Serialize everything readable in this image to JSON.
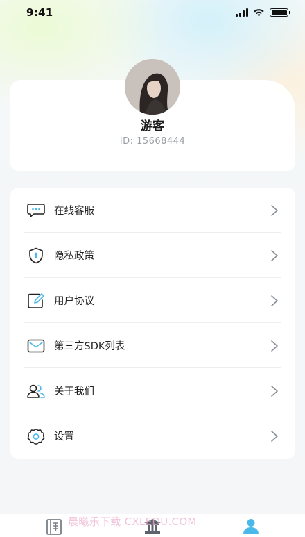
{
  "status_bar": {
    "time": "9:41"
  },
  "profile": {
    "name": "游客",
    "id_text": "ID: 15668444"
  },
  "menu": {
    "items": [
      {
        "label": "在线客服",
        "icon": "chat-bubble-icon"
      },
      {
        "label": "隐私政策",
        "icon": "shield-icon"
      },
      {
        "label": "用户协议",
        "icon": "edit-document-icon"
      },
      {
        "label": "第三方SDK列表",
        "icon": "envelope-icon"
      },
      {
        "label": "关于我们",
        "icon": "users-icon"
      },
      {
        "label": "设置",
        "icon": "gear-icon"
      }
    ]
  },
  "tab_bar": {
    "tabs": [
      {
        "icon": "bookshelf-icon",
        "active": false
      },
      {
        "icon": "temple-icon",
        "active": false
      },
      {
        "icon": "profile-icon",
        "active": true
      }
    ],
    "watermark": "晨曦乐下载 CXLEDU.COM"
  },
  "colors": {
    "accent": "#4ab8e8",
    "text": "#222222",
    "muted": "#9a9ea6",
    "tab_inactive": "#7a7f87"
  }
}
